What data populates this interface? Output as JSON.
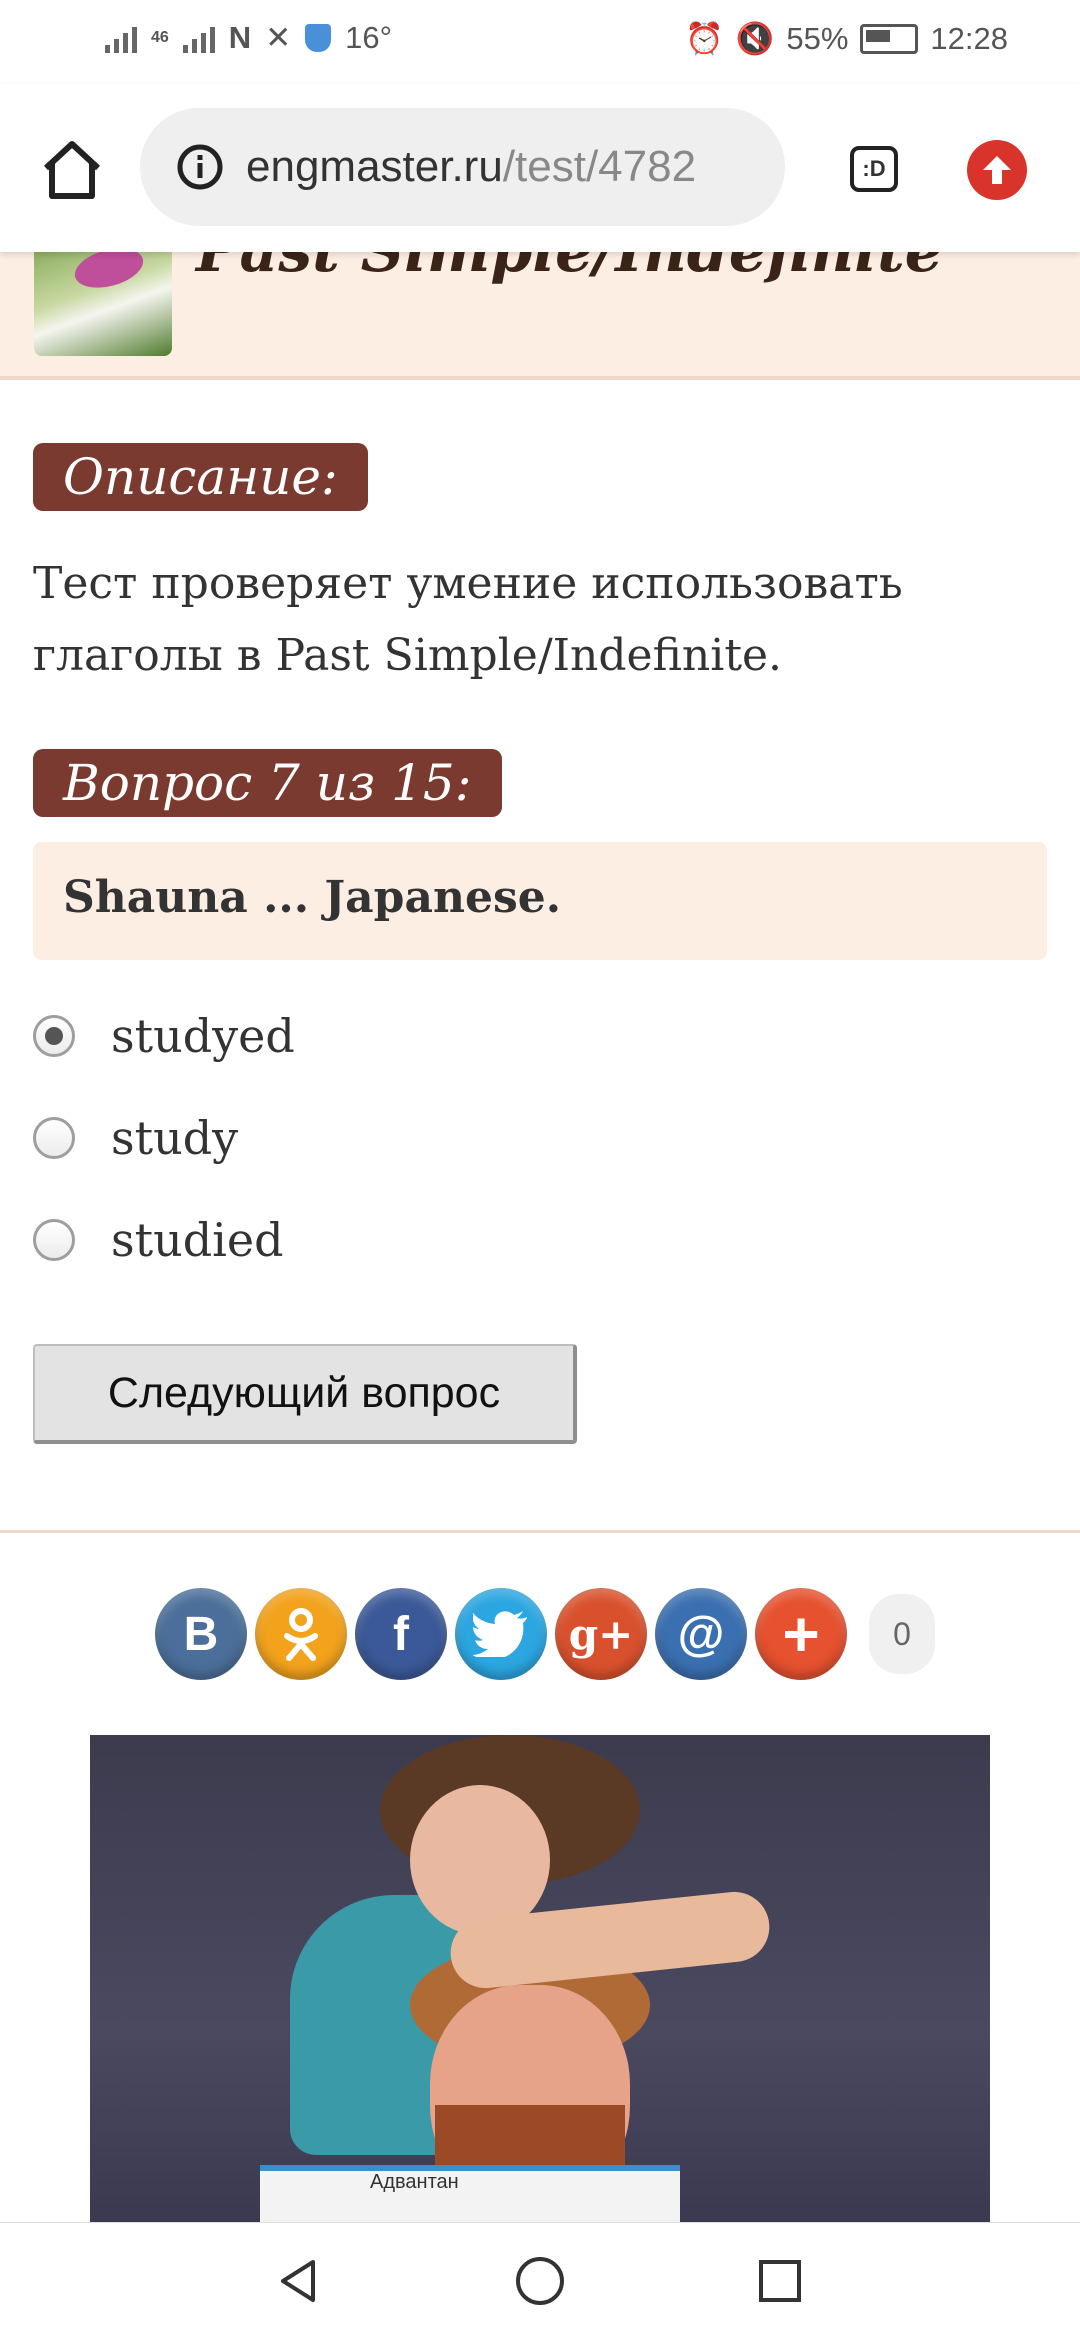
{
  "status_bar": {
    "network": "46",
    "temperature": "16°",
    "battery": "55%",
    "time": "12:28"
  },
  "browser": {
    "url_domain": "engmaster.ru",
    "url_path": "/test/4782",
    "tabs_label": ":D"
  },
  "page": {
    "header_title": "Past Simple/Indefinite",
    "description_tag": "Описание:",
    "description_text": "Тест проверяет умение использовать глаголы в Past Simple/Indefinite.",
    "question_tag": "Вопрос 7 из 15:",
    "question_text": "Shauna ... Japanese.",
    "options": [
      {
        "label": "studyed",
        "checked": true
      },
      {
        "label": "study",
        "checked": false
      },
      {
        "label": "studied",
        "checked": false
      }
    ],
    "next_button": "Следующий вопрос"
  },
  "share": {
    "buttons": [
      {
        "name": "vk",
        "glyph": "B",
        "color": "#4b6f9a"
      },
      {
        "name": "odnoklassniki",
        "glyph": "ok",
        "color": "#f2a21b"
      },
      {
        "name": "facebook",
        "glyph": "f",
        "color": "#3b5998"
      },
      {
        "name": "twitter",
        "glyph": "t",
        "color": "#2ba6e1"
      },
      {
        "name": "google-plus",
        "glyph": "g+",
        "color": "#d9512c"
      },
      {
        "name": "mail",
        "glyph": "@",
        "color": "#3a6fb0"
      },
      {
        "name": "more",
        "glyph": "+",
        "color": "#e6512f"
      }
    ],
    "count": "0"
  },
  "ad": {
    "box_text": "Адвантан"
  },
  "colors": {
    "accent_tag": "#7a3a2f",
    "question_bg": "#fdeee4"
  }
}
